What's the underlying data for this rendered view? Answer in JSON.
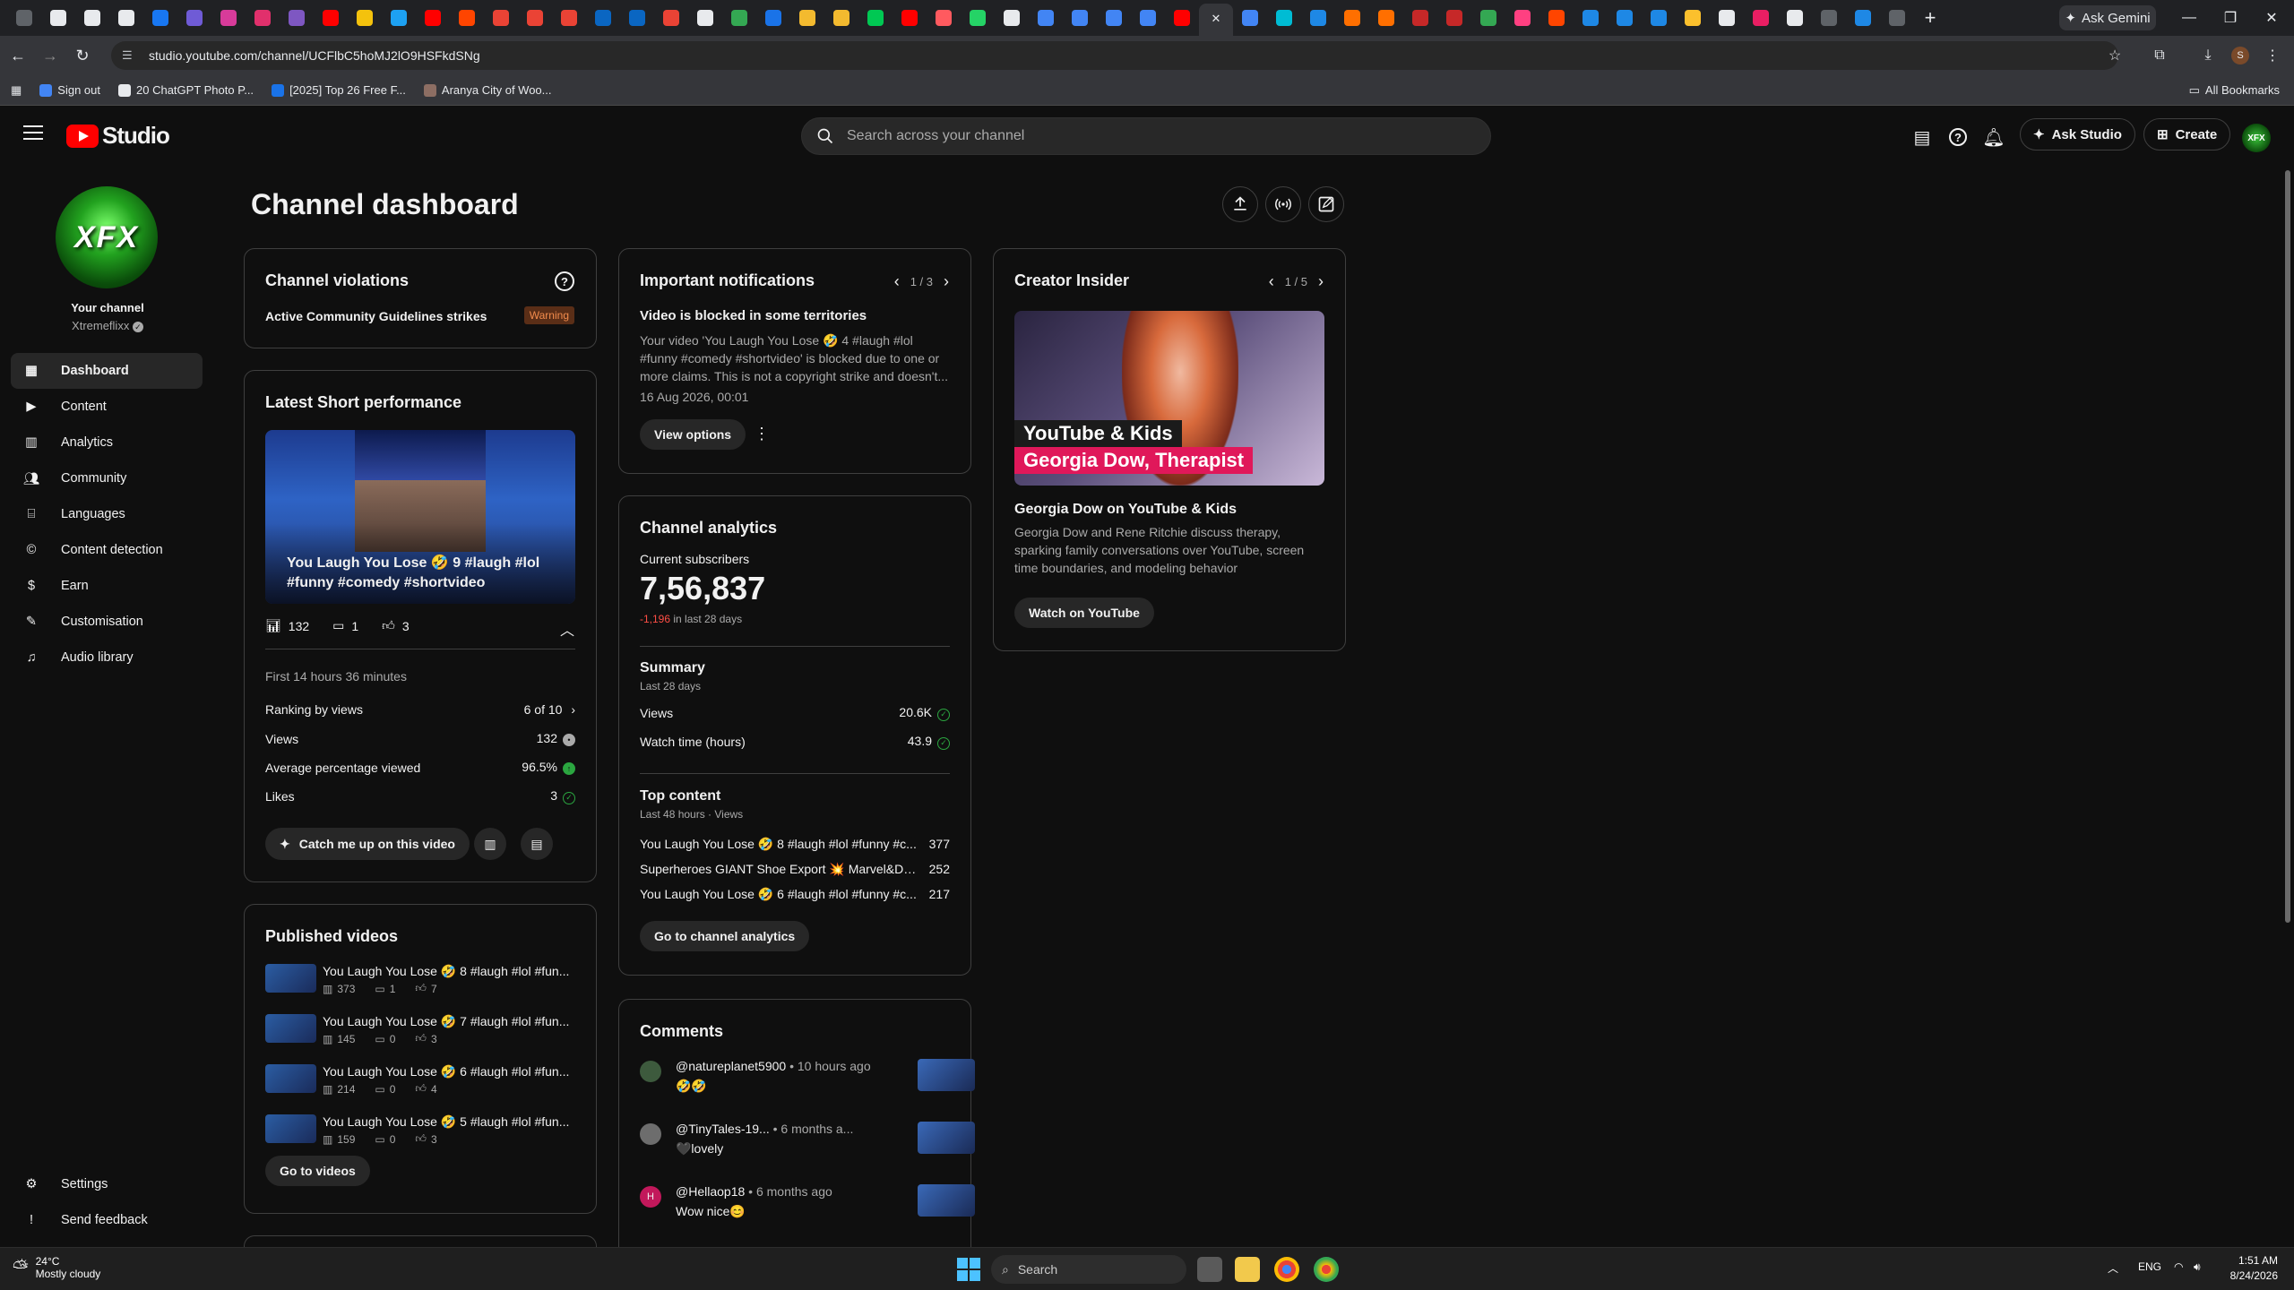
{
  "browser": {
    "tab_colors": [
      "#5f6368",
      "#e8eaed",
      "#e8eaed",
      "#e8eaed",
      "#1877f2",
      "#6f5bd6",
      "#d83b9a",
      "#e1306c",
      "#7e57c2",
      "#ff0000",
      "#f4c20d",
      "#1da1f2",
      "#ff0000",
      "#ff4500",
      "#ea4335",
      "#ea4335",
      "#ea4335",
      "#0a66c2",
      "#0a66c2",
      "#ea4335",
      "#e8eaed",
      "#34a853",
      "#1a73e8",
      "#f3ba2f",
      "#f3ba2f",
      "#00c853",
      "#ff0000",
      "#ff5a5f",
      "#25d366",
      "#e8eaed",
      "#4285f4",
      "#4285f4",
      "#4285f4",
      "#4285f4",
      "#ff0000",
      "#35363a",
      "#4285f4",
      "#00bcd4",
      "#1e88e5",
      "#ff6f00",
      "#ff6f00",
      "#c62828",
      "#c62828",
      "#34a853",
      "#ff4081",
      "#ff4500",
      "#1e88e5",
      "#1e88e5",
      "#1e88e5",
      "#fbc02d",
      "#e8eaed",
      "#e91e63",
      "#e8eaed",
      "#5f6368",
      "#1e88e5",
      "#5f6368"
    ],
    "new_tab": "+",
    "ask_gemini": "Ask Gemini",
    "url": "studio.youtube.com/channel/UCFlbC5hoMJ2lO9HSFkdSNg",
    "bookmarks": [
      {
        "label": "Sign out",
        "color": "#4285f4"
      },
      {
        "label": "20 ChatGPT Photo P...",
        "color": "#e8eaed"
      },
      {
        "label": "[2025] Top 26 Free F...",
        "color": "#1a73e8"
      },
      {
        "label": "Aranya City of Woo...",
        "color": "#8d6e63"
      }
    ],
    "all_bookmarks": "All Bookmarks"
  },
  "header": {
    "logo_text": "Studio",
    "search_placeholder": "Search across your channel",
    "ask_studio": "Ask Studio",
    "create": "Create",
    "avatar_text": "XFX"
  },
  "sidebar": {
    "avatar_text": "XFX",
    "channel_label": "Your channel",
    "channel_handle": "Xtremeflixx",
    "items": [
      {
        "label": "Dashboard",
        "icon": "dashboard-icon",
        "active": true
      },
      {
        "label": "Content",
        "icon": "content-icon"
      },
      {
        "label": "Analytics",
        "icon": "analytics-icon"
      },
      {
        "label": "Community",
        "icon": "community-icon"
      },
      {
        "label": "Languages",
        "icon": "languages-icon"
      },
      {
        "label": "Content detection",
        "icon": "content-detection-icon"
      },
      {
        "label": "Earn",
        "icon": "earn-icon"
      },
      {
        "label": "Customisation",
        "icon": "customisation-icon"
      },
      {
        "label": "Audio library",
        "icon": "audio-library-icon"
      }
    ],
    "bottom": [
      {
        "label": "Settings",
        "icon": "gear-icon"
      },
      {
        "label": "Send feedback",
        "icon": "feedback-icon"
      }
    ]
  },
  "page": {
    "title": "Channel dashboard"
  },
  "violations": {
    "title": "Channel violations",
    "label": "Active Community Guidelines strikes",
    "badge": "Warning"
  },
  "short_perf": {
    "title": "Latest Short performance",
    "video_title": "You Laugh You Lose 🤣 9 #laugh #lol #funny #comedy #shortvideo",
    "views": "132",
    "comments": "1",
    "likes": "3",
    "period": "First 14 hours 36 minutes",
    "rows": [
      {
        "label": "Ranking by views",
        "value": "6 of 10"
      },
      {
        "label": "Views",
        "value": "132"
      },
      {
        "label": "Average percentage viewed",
        "value": "96.5%"
      },
      {
        "label": "Likes",
        "value": "3"
      }
    ],
    "catch_up": "Catch me up on this video"
  },
  "published": {
    "title": "Published videos",
    "videos": [
      {
        "title": "You Laugh You Lose 🤣 8 #laugh #lol #fun...",
        "views": "373",
        "comments": "1",
        "likes": "7"
      },
      {
        "title": "You Laugh You Lose 🤣 7 #laugh #lol #fun...",
        "views": "145",
        "comments": "0",
        "likes": "3"
      },
      {
        "title": "You Laugh You Lose 🤣 6 #laugh #lol #fun...",
        "views": "214",
        "comments": "0",
        "likes": "4"
      },
      {
        "title": "You Laugh You Lose 🤣 5 #laugh #lol #fun...",
        "views": "159",
        "comments": "0",
        "likes": "3"
      }
    ],
    "go": "Go to videos"
  },
  "notifications": {
    "title": "Important notifications",
    "pager": "1 / 3",
    "heading": "Video is blocked in some territories",
    "body": "Your video 'You Laugh You Lose 🤣 4 #laugh #lol #funny #comedy #shortvideo' is blocked due to one or more claims. This is not a copyright strike and doesn't...",
    "date": "16 Aug 2026, 00:01",
    "view_options": "View options"
  },
  "analytics": {
    "title": "Channel analytics",
    "subs_label": "Current subscribers",
    "subs_value": "7,56,837",
    "subs_change": "-1,196",
    "subs_change_suffix": " in last 28 days",
    "summary_title": "Summary",
    "summary_period": "Last 28 days",
    "rows": [
      {
        "label": "Views",
        "value": "20.6K"
      },
      {
        "label": "Watch time (hours)",
        "value": "43.9"
      }
    ],
    "top_title": "Top content",
    "top_period": "Last 48 hours · Views",
    "top": [
      {
        "title": "You Laugh You Lose 🤣 8 #laugh #lol #funny #c...",
        "views": "377"
      },
      {
        "title": "Superheroes GIANT Shoe Export 💥 Marvel&DC-A...",
        "views": "252"
      },
      {
        "title": "You Laugh You Lose 🤣 6 #laugh #lol #funny #c...",
        "views": "217"
      }
    ],
    "go": "Go to channel analytics"
  },
  "comments": {
    "title": "Comments",
    "items": [
      {
        "author": "@natureplanet5900",
        "time": " • 10 hours ago",
        "text": "🤣🤣",
        "avatar_color": "#3d5a3d"
      },
      {
        "author": "@TinyTales-19...",
        "time": " • 6 months a...",
        "text": "🖤lovely",
        "avatar_color": "#6d6d6d"
      },
      {
        "author": "@Hellaop18",
        "time": " • 6 months ago",
        "text": "Wow nice😊",
        "avatar_color": "#c2185b",
        "avatar_letter": "H"
      }
    ]
  },
  "insider": {
    "title": "Creator Insider",
    "pager": "1 / 5",
    "thumb_line1": "YouTube & Kids",
    "thumb_line2": "Georgia Dow, Therapist",
    "heading": "Georgia Dow on YouTube & Kids",
    "body": "Georgia Dow and Rene Ritchie discuss therapy, sparking family conversations over YouTube, screen time boundaries, and modeling behavior",
    "watch": "Watch on YouTube"
  },
  "taskbar": {
    "temp": "24°C",
    "weather": "Mostly cloudy",
    "search": "Search",
    "lang": "ENG",
    "time": "1:51 AM",
    "date": "8/24/2026"
  }
}
